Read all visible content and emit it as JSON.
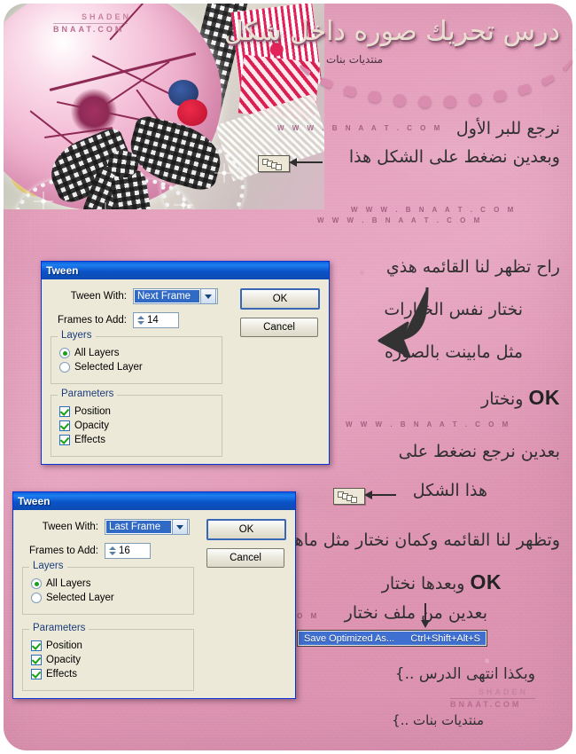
{
  "page": {
    "title_arabic": "درس تحريك صوره داخل شكل",
    "subtitle_arabic": "منتديات بنات",
    "watermark_shaden": "SHADEN",
    "watermark_bnaat": "BNAAT.COM",
    "watermark_www": "W W W . B N A A T . C O M",
    "bg_color": "#e49fbb",
    "title_color": "#e9e0d2"
  },
  "annotations": {
    "line1": "نرجع للبر الأول",
    "line2": "وبعدين نضغط على الشكل هذا",
    "line3": "راح تظهر لنا القائمه هذي",
    "line4": "نختار نفس الخيارات",
    "line5": "مثل مابينت بالصوره",
    "line6_prefix": "ونختار",
    "line6_ok": "OK",
    "line7": "بعدين نرجع نضغط على",
    "line8": "هذا الشكل",
    "line9": "وتظهر لنا القائمه وكمان نختار مثل ماهو مبين",
    "line10_prefix": "وبعدها نختار",
    "line10_ok": "OK",
    "line11": "بعدين من ملف نختار",
    "line12": "وبكذا انتهى الدرس ..}",
    "line13": "منتديات بنات ..}"
  },
  "menu": {
    "label": "Save Optimized As...",
    "shortcut": "Ctrl+Shift+Alt+S",
    "highlight_color": "#3f6fd0"
  },
  "dialogs": [
    {
      "title": "Tween",
      "tween_with_label": "Tween With:",
      "tween_with_value": "Next Frame",
      "frames_label": "Frames to Add:",
      "frames_value": "14",
      "ok_label": "OK",
      "cancel_label": "Cancel",
      "layers_group": "Layers",
      "layers_options": [
        "All Layers",
        "Selected Layer"
      ],
      "layers_selected": "All Layers",
      "parameters_group": "Parameters",
      "parameters": [
        {
          "label": "Position",
          "checked": true
        },
        {
          "label": "Opacity",
          "checked": true
        },
        {
          "label": "Effects",
          "checked": true
        }
      ]
    },
    {
      "title": "Tween",
      "tween_with_label": "Tween With:",
      "tween_with_value": "Last Frame",
      "frames_label": "Frames to Add:",
      "frames_value": "16",
      "ok_label": "OK",
      "cancel_label": "Cancel",
      "layers_group": "Layers",
      "layers_options": [
        "All Layers",
        "Selected Layer"
      ],
      "layers_selected": "All Layers",
      "parameters_group": "Parameters",
      "parameters": [
        {
          "label": "Position",
          "checked": true
        },
        {
          "label": "Opacity",
          "checked": true
        },
        {
          "label": "Effects",
          "checked": true
        }
      ]
    }
  ]
}
